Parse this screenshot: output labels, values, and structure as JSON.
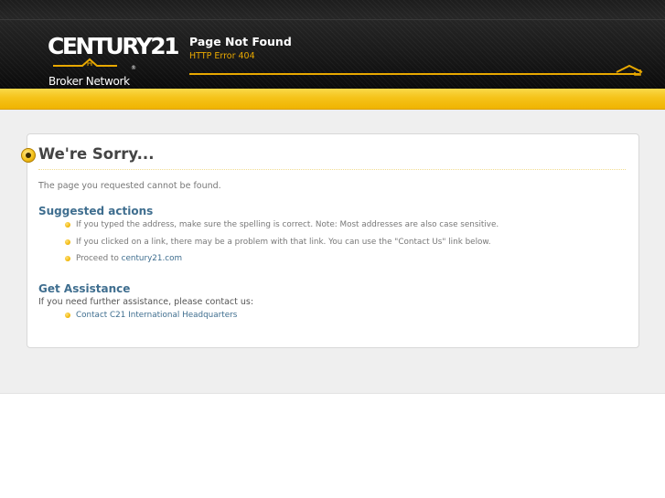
{
  "logo": {
    "brand": "CENTURY21",
    "registered": "®",
    "subtitle": "Broker Network"
  },
  "header": {
    "title": "Page Not Found",
    "subtitle": "HTTP Error 404"
  },
  "content": {
    "heading": "We're Sorry...",
    "message": "The page you requested cannot be found.",
    "suggested": {
      "heading": "Suggested actions",
      "items": [
        "If you typed the address, make sure the spelling is correct. Note: Most addresses are also case sensitive.",
        "If you clicked on a link, there may be a problem with that link. You can use the \"Contact Us\" link below."
      ],
      "proceed_prefix": "Proceed to",
      "proceed_link": "century21.com"
    },
    "assistance": {
      "heading": "Get Assistance",
      "text": "If you need further assistance, please contact us:",
      "link": "Contact C21 International Headquarters"
    }
  },
  "colors": {
    "accent": "#f5c31a",
    "header_bg": "#1a1a1a",
    "link": "#3f6e8f"
  }
}
